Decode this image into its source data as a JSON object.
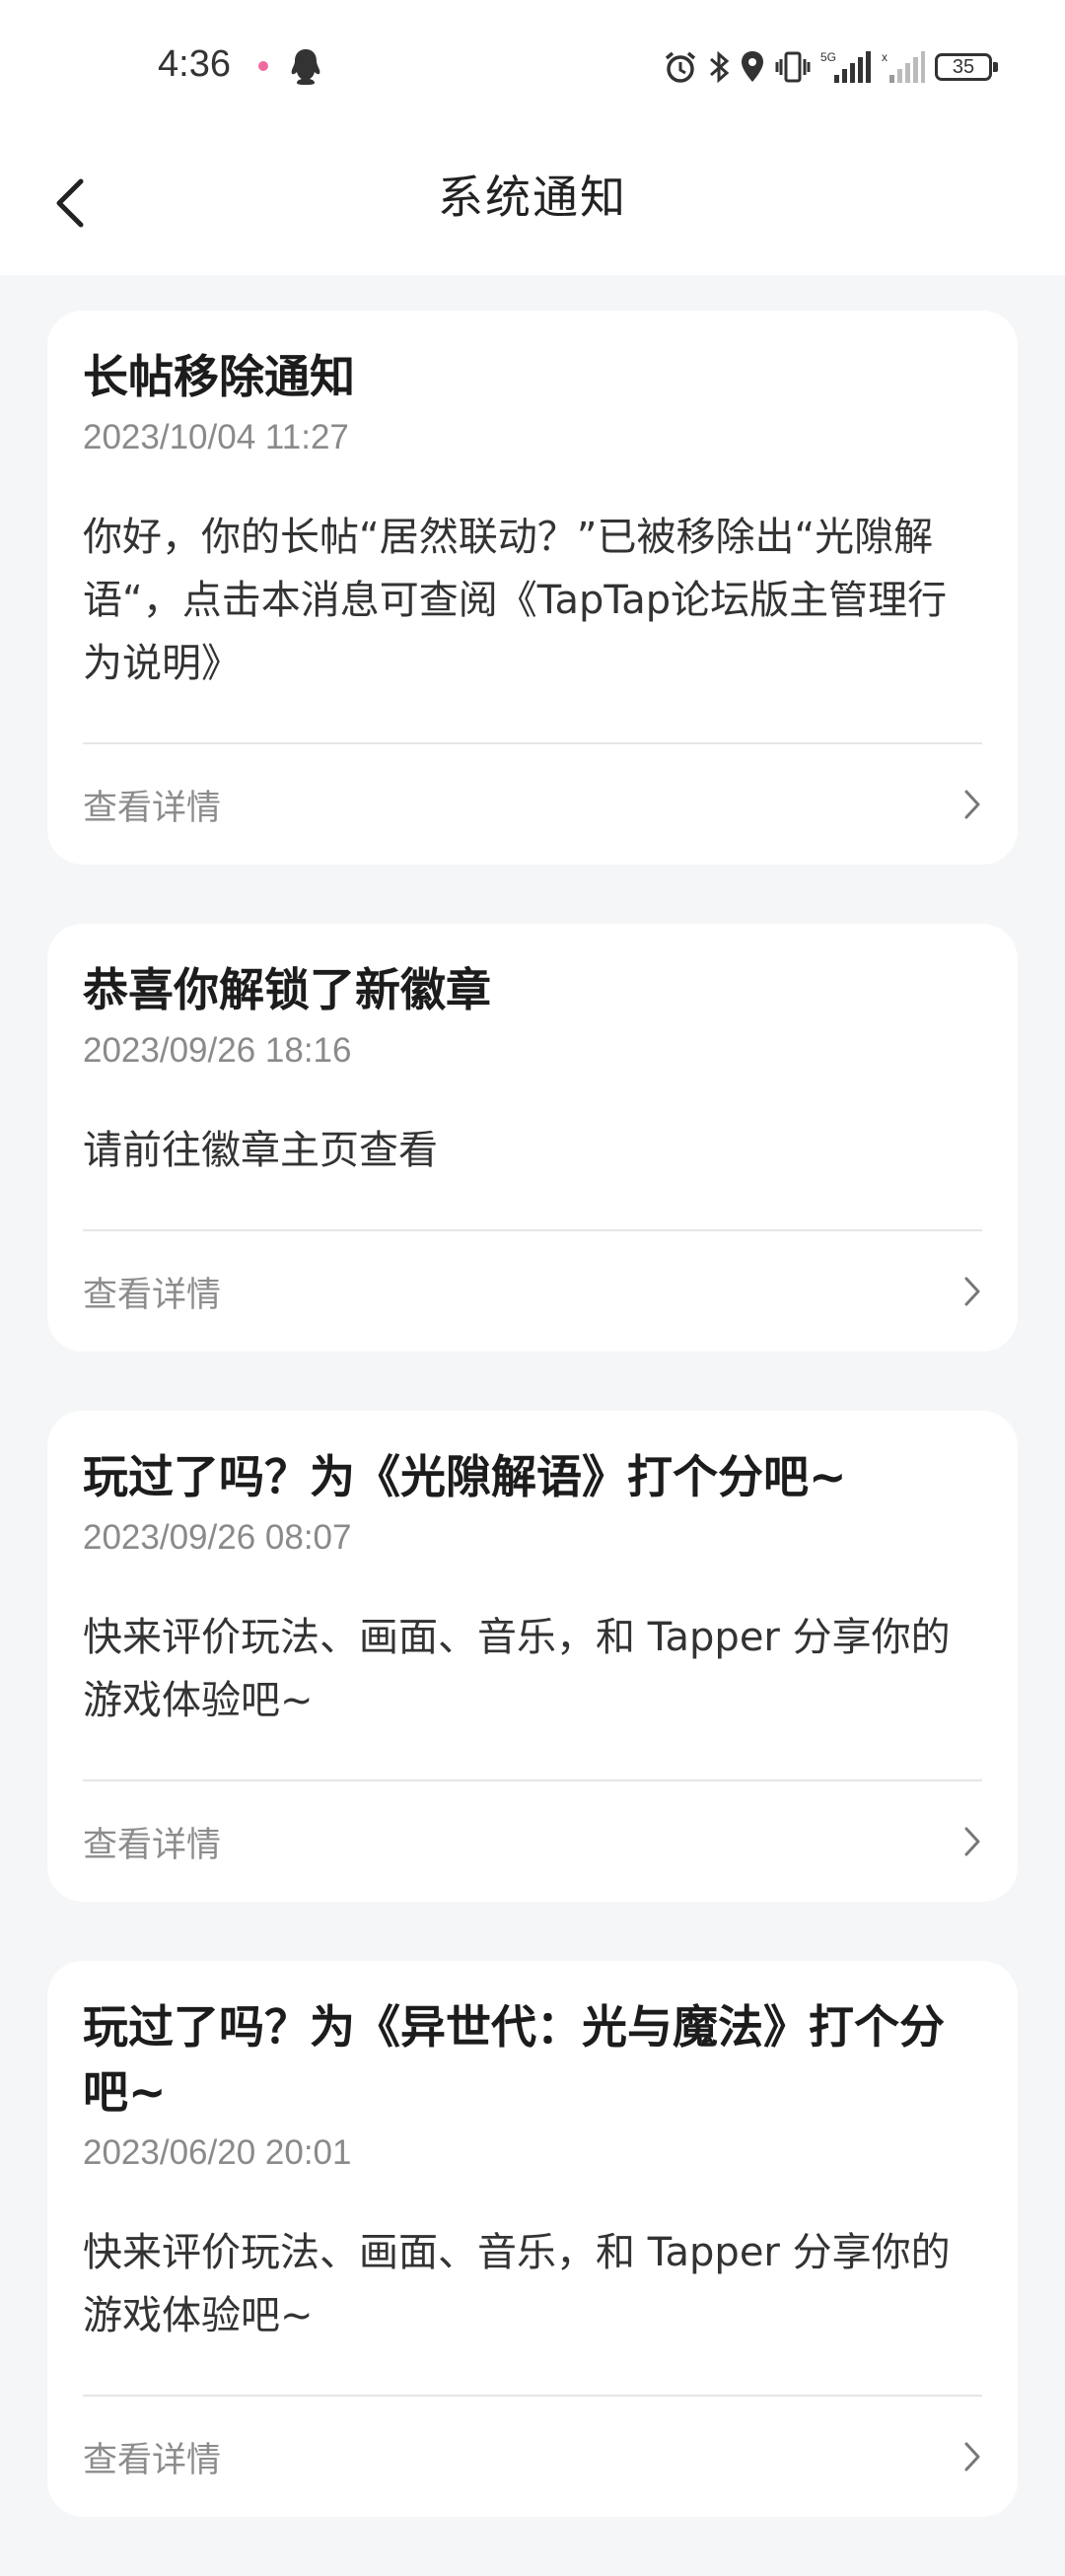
{
  "status_bar": {
    "time": "4:36",
    "battery": "35"
  },
  "header": {
    "title": "系统通知"
  },
  "notifications": [
    {
      "title": "长帖移除通知",
      "time": "2023/10/04 11:27",
      "body": "你好，你的长帖“居然联动？”已被移除出“光隙解语“，点击本消息可查阅《TapTap论坛版主管理行为说明》",
      "details_label": "查看详情"
    },
    {
      "title": "恭喜你解锁了新徽章",
      "time": "2023/09/26 18:16",
      "body": "请前往徽章主页查看",
      "details_label": "查看详情"
    },
    {
      "title": "玩过了吗？为《光隙解语》打个分吧~",
      "time": "2023/09/26 08:07",
      "body": "快来评价玩法、画面、音乐，和 Tapper 分享你的游戏体验吧~",
      "details_label": "查看详情"
    },
    {
      "title": "玩过了吗？为《异世代：光与魔法》打个分吧~",
      "time": "2023/06/20 20:01",
      "body": "快来评价玩法、画面、音乐，和 Tapper 分享你的游戏体验吧~",
      "details_label": "查看详情"
    }
  ]
}
